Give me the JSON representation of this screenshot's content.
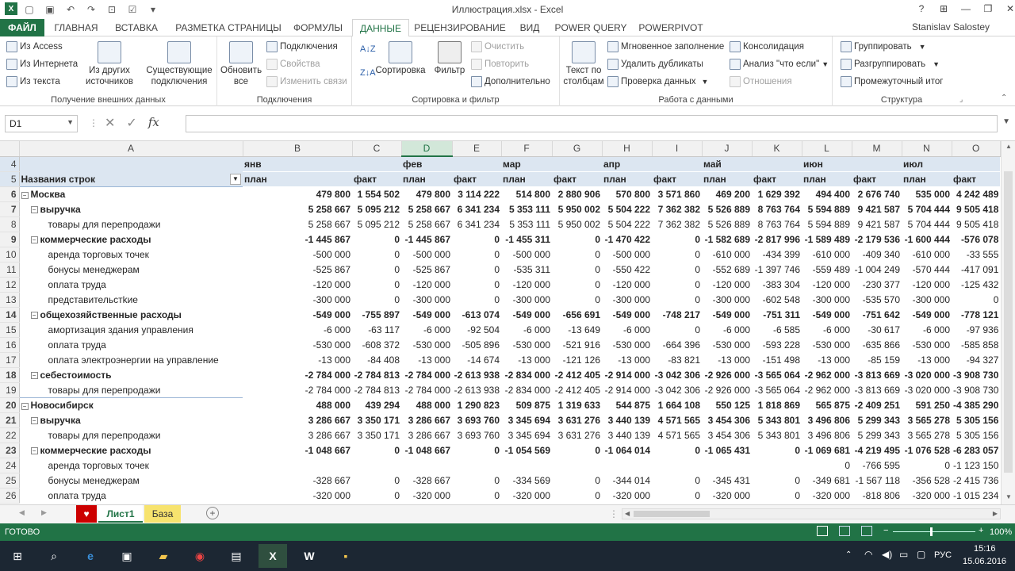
{
  "app": {
    "title": "Иллюстрация.xlsx - Excel",
    "user": "Stanislav Salostey"
  },
  "tabs": [
    "ФАЙЛ",
    "ГЛАВНАЯ",
    "ВСТАВКА",
    "РАЗМЕТКА СТРАНИЦЫ",
    "ФОРМУЛЫ",
    "ДАННЫЕ",
    "РЕЦЕНЗИРОВАНИЕ",
    "ВИД",
    "POWER QUERY",
    "POWERPIVOT"
  ],
  "ribbon": {
    "g1": {
      "label": "Получение внешних данных",
      "access": "Из Access",
      "web": "Из Интернета",
      "text": "Из текста",
      "other1": "Из других",
      "other2": "источников",
      "exist1": "Существующие",
      "exist2": "подключения"
    },
    "g2": {
      "label": "Подключения",
      "refresh1": "Обновить",
      "refresh2": "все",
      "conn": "Подключения",
      "props": "Свойства",
      "links": "Изменить связи"
    },
    "g3": {
      "label": "Сортировка и фильтр",
      "sort": "Сортировка",
      "filter": "Фильтр",
      "clear": "Очистить",
      "reapply": "Повторить",
      "advanced": "Дополнительно"
    },
    "g4": {
      "label": "Работа с данными",
      "ttc1": "Текст по",
      "ttc2": "столбцам",
      "flash": "Мгновенное заполнение",
      "dups": "Удалить дубликаты",
      "valid": "Проверка данных",
      "consol": "Консолидация",
      "whatif": "Анализ \"что если\"",
      "rel": "Отношения"
    },
    "g5": {
      "label": "Структура",
      "group": "Группировать",
      "ungroup": "Разгруппировать",
      "subtotal": "Промежуточный итог"
    }
  },
  "formula": {
    "namebox": "D1",
    "fx": "fx",
    "value": ""
  },
  "columns": [
    "A",
    "B",
    "C",
    "D",
    "E",
    "F",
    "G",
    "H",
    "I",
    "J",
    "K",
    "L",
    "M",
    "N",
    "O"
  ],
  "rows": [
    {
      "n": "4",
      "t": "hdr",
      "a": "",
      "v": [
        "янв",
        "",
        "фев",
        "",
        "мар",
        "",
        "апр",
        "",
        "май",
        "",
        "июн",
        "",
        "июл",
        ""
      ]
    },
    {
      "n": "5",
      "t": "hdr",
      "a": "Названия строк",
      "v": [
        "план",
        "факт",
        "план",
        "факт",
        "план",
        "факт",
        "план",
        "факт",
        "план",
        "факт",
        "план",
        "факт",
        "план",
        "факт"
      ]
    },
    {
      "n": "6",
      "t": "city",
      "a": "Москва",
      "v": [
        "479 800",
        "1 554 502",
        "479 800",
        "3 114 222",
        "514 800",
        "2 880 906",
        "570 800",
        "3 571 860",
        "469 200",
        "1 629 392",
        "494 400",
        "2 676 740",
        "535 000",
        "4 242 489"
      ]
    },
    {
      "n": "7",
      "t": "sub",
      "a": "выручка",
      "v": [
        "5 258 667",
        "5 095 212",
        "5 258 667",
        "6 341 234",
        "5 353 111",
        "5 950 002",
        "5 504 222",
        "7 362 382",
        "5 526 889",
        "8 763 764",
        "5 594 889",
        "9 421 587",
        "5 704 444",
        "9 505 418"
      ]
    },
    {
      "n": "8",
      "t": "item",
      "a": "товары для перепродажи",
      "v": [
        "5 258 667",
        "5 095 212",
        "5 258 667",
        "6 341 234",
        "5 353 111",
        "5 950 002",
        "5 504 222",
        "7 362 382",
        "5 526 889",
        "8 763 764",
        "5 594 889",
        "9 421 587",
        "5 704 444",
        "9 505 418"
      ]
    },
    {
      "n": "9",
      "t": "sub",
      "a": "коммерческие расходы",
      "v": [
        "-1 445 867",
        "0",
        "-1 445 867",
        "0",
        "-1 455 311",
        "0",
        "-1 470 422",
        "0",
        "-1 582 689",
        "-2 817 996",
        "-1 589 489",
        "-2 179 536",
        "-1 600 444",
        "-576 078"
      ]
    },
    {
      "n": "10",
      "t": "item",
      "a": "аренда торговых точек",
      "v": [
        "-500 000",
        "0",
        "-500 000",
        "0",
        "-500 000",
        "0",
        "-500 000",
        "0",
        "-610 000",
        "-434 399",
        "-610 000",
        "-409 340",
        "-610 000",
        "-33 555"
      ]
    },
    {
      "n": "11",
      "t": "item",
      "a": "бонусы менеджерам",
      "v": [
        "-525 867",
        "0",
        "-525 867",
        "0",
        "-535 311",
        "0",
        "-550 422",
        "0",
        "-552 689",
        "-1 397 746",
        "-559 489",
        "-1 004 249",
        "-570 444",
        "-417 091"
      ]
    },
    {
      "n": "12",
      "t": "item",
      "a": "оплата труда",
      "v": [
        "-120 000",
        "0",
        "-120 000",
        "0",
        "-120 000",
        "0",
        "-120 000",
        "0",
        "-120 000",
        "-383 304",
        "-120 000",
        "-230 377",
        "-120 000",
        "-125 432"
      ]
    },
    {
      "n": "13",
      "t": "item",
      "a": "представительстkие",
      "v": [
        "-300 000",
        "0",
        "-300 000",
        "0",
        "-300 000",
        "0",
        "-300 000",
        "0",
        "-300 000",
        "-602 548",
        "-300 000",
        "-535 570",
        "-300 000",
        "0"
      ]
    },
    {
      "n": "14",
      "t": "sub",
      "a": "общехозяйственные расходы",
      "v": [
        "-549 000",
        "-755 897",
        "-549 000",
        "-613 074",
        "-549 000",
        "-656 691",
        "-549 000",
        "-748 217",
        "-549 000",
        "-751 311",
        "-549 000",
        "-751 642",
        "-549 000",
        "-778 121"
      ]
    },
    {
      "n": "15",
      "t": "item",
      "a": "амортизация здания управления",
      "v": [
        "-6 000",
        "-63 117",
        "-6 000",
        "-92 504",
        "-6 000",
        "-13 649",
        "-6 000",
        "0",
        "-6 000",
        "-6 585",
        "-6 000",
        "-30 617",
        "-6 000",
        "-97 936"
      ]
    },
    {
      "n": "16",
      "t": "item",
      "a": "оплата труда",
      "v": [
        "-530 000",
        "-608 372",
        "-530 000",
        "-505 896",
        "-530 000",
        "-521 916",
        "-530 000",
        "-664 396",
        "-530 000",
        "-593 228",
        "-530 000",
        "-635 866",
        "-530 000",
        "-585 858"
      ]
    },
    {
      "n": "17",
      "t": "item",
      "a": "оплата электроэнергии на управление",
      "v": [
        "-13 000",
        "-84 408",
        "-13 000",
        "-14 674",
        "-13 000",
        "-121 126",
        "-13 000",
        "-83 821",
        "-13 000",
        "-151 498",
        "-13 000",
        "-85 159",
        "-13 000",
        "-94 327"
      ]
    },
    {
      "n": "18",
      "t": "sub",
      "a": "себестоимость",
      "v": [
        "-2 784 000",
        "-2 784 813",
        "-2 784 000",
        "-2 613 938",
        "-2 834 000",
        "-2 412 405",
        "-2 914 000",
        "-3 042 306",
        "-2 926 000",
        "-3 565 064",
        "-2 962 000",
        "-3 813 669",
        "-3 020 000",
        "-3 908 730"
      ]
    },
    {
      "n": "19",
      "t": "item",
      "a": "товары для перепродажи",
      "v": [
        "-2 784 000",
        "-2 784 813",
        "-2 784 000",
        "-2 613 938",
        "-2 834 000",
        "-2 412 405",
        "-2 914 000",
        "-3 042 306",
        "-2 926 000",
        "-3 565 064",
        "-2 962 000",
        "-3 813 669",
        "-3 020 000",
        "-3 908 730"
      ]
    },
    {
      "n": "20",
      "t": "city",
      "a": "Новосибирск",
      "v": [
        "488 000",
        "439 294",
        "488 000",
        "1 290 823",
        "509 875",
        "1 319 633",
        "544 875",
        "1 664 108",
        "550 125",
        "1 818 869",
        "565 875",
        "-2 409 251",
        "591 250",
        "-4 385 290"
      ]
    },
    {
      "n": "21",
      "t": "sub",
      "a": "выручка",
      "v": [
        "3 286 667",
        "3 350 171",
        "3 286 667",
        "3 693 760",
        "3 345 694",
        "3 631 276",
        "3 440 139",
        "4 571 565",
        "3 454 306",
        "5 343 801",
        "3 496 806",
        "5 299 343",
        "3 565 278",
        "5 305 156"
      ]
    },
    {
      "n": "22",
      "t": "item",
      "a": "товары для перепродажи",
      "v": [
        "3 286 667",
        "3 350 171",
        "3 286 667",
        "3 693 760",
        "3 345 694",
        "3 631 276",
        "3 440 139",
        "4 571 565",
        "3 454 306",
        "5 343 801",
        "3 496 806",
        "5 299 343",
        "3 565 278",
        "5 305 156"
      ]
    },
    {
      "n": "23",
      "t": "sub",
      "a": "коммерческие расходы",
      "v": [
        "-1 048 667",
        "0",
        "-1 048 667",
        "0",
        "-1 054 569",
        "0",
        "-1 064 014",
        "0",
        "-1 065 431",
        "0",
        "-1 069 681",
        "-4 219 495",
        "-1 076 528",
        "-6 283 057"
      ]
    },
    {
      "n": "24",
      "t": "item",
      "a": "аренда торговых точек",
      "v": [
        "",
        "",
        "",
        "",
        "",
        "",
        "",
        "",
        "",
        "",
        "",
        "0",
        "-766 595",
        "0",
        "-1 123 150"
      ]
    },
    {
      "n": "25",
      "t": "item",
      "a": "бонусы менеджерам",
      "v": [
        "-328 667",
        "0",
        "-328 667",
        "0",
        "-334 569",
        "0",
        "-344 014",
        "0",
        "-345 431",
        "0",
        "-349 681",
        "-1 567 118",
        "-356 528",
        "-2 415 736"
      ]
    },
    {
      "n": "26",
      "t": "item",
      "a": "оплата труда",
      "v": [
        "-320 000",
        "0",
        "-320 000",
        "0",
        "-320 000",
        "0",
        "-320 000",
        "0",
        "-320 000",
        "0",
        "-320 000",
        "-818 806",
        "-320 000",
        "-1 015 234"
      ]
    }
  ],
  "sheets": [
    "Лист1",
    "База"
  ],
  "status": {
    "ready": "ГОТОВО",
    "zoom": "100%"
  },
  "taskbar": {
    "lang": "РУС",
    "time": "15:16",
    "date": "15.06.2016"
  }
}
